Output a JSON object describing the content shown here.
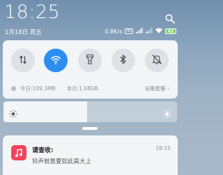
{
  "status": {
    "time": "18:25",
    "date": "1月18日 周五",
    "network_speed": "0.8K/s",
    "volte": "HD",
    "battery": "42"
  },
  "quick_toggles": [
    {
      "name": "mobile-data",
      "icon": "data-arrows-icon",
      "active": false
    },
    {
      "name": "wifi",
      "icon": "wifi-icon",
      "active": true
    },
    {
      "name": "flashlight",
      "icon": "flashlight-icon",
      "active": false
    },
    {
      "name": "bluetooth",
      "icon": "bluetooth-icon",
      "active": false
    },
    {
      "name": "silent",
      "icon": "bell-off-icon",
      "active": false
    }
  ],
  "data_usage": {
    "today": "今日:109.3MB",
    "month": "本月:1.08GB",
    "settings_link": "设置套餐 ›"
  },
  "brightness": {
    "level": 0.48
  },
  "notification": {
    "title": "请查收:",
    "body": "铃声就是要如此高大上",
    "time": "18:15",
    "app_color": "#f0435c"
  },
  "colors": {
    "accent": "#2b8ff0",
    "panel_bg": "#f2f4f6"
  }
}
